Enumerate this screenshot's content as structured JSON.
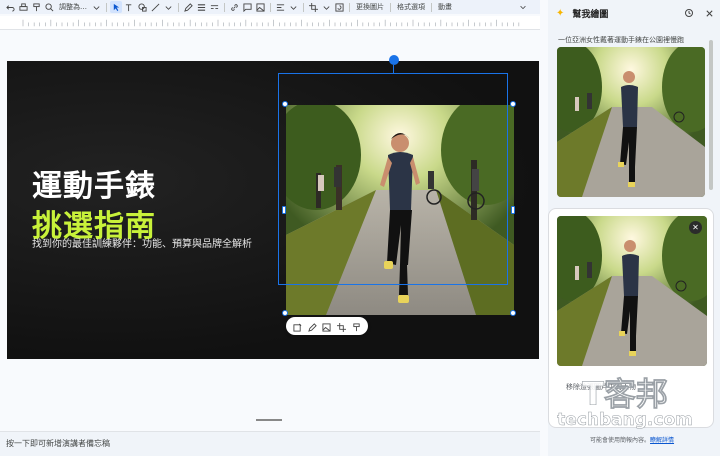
{
  "toolbar": {
    "zoom_label": "調整為…",
    "replace_image": "更換圖片",
    "format_options": "格式選項",
    "animation": "動畫"
  },
  "slide": {
    "title_line1": "運動手錶",
    "title_line2": "挑選指南",
    "subtitle": "找到你的最佳訓練夥伴：功能、預算與品牌全解析",
    "title_color": "#ffffff",
    "accent_color": "#c8f23a",
    "background_color": "#121212"
  },
  "notes": {
    "placeholder": "按一下即可新增演講者備忘稿"
  },
  "panel": {
    "title": "幫我繪圖",
    "prompt_text": "一位亞洲女性戴著運動手錶在公園裡慢跑",
    "caption_partial": "移除這張圖片中的人物",
    "footer_text": "可能會使用簡報內容。",
    "footer_link": "瞭解詳情"
  },
  "watermark": {
    "brand_cn": "T客邦",
    "brand_url": "techbang.com"
  },
  "colors": {
    "selection": "#1a73e8",
    "panel_bg": "#f0f4f9"
  }
}
